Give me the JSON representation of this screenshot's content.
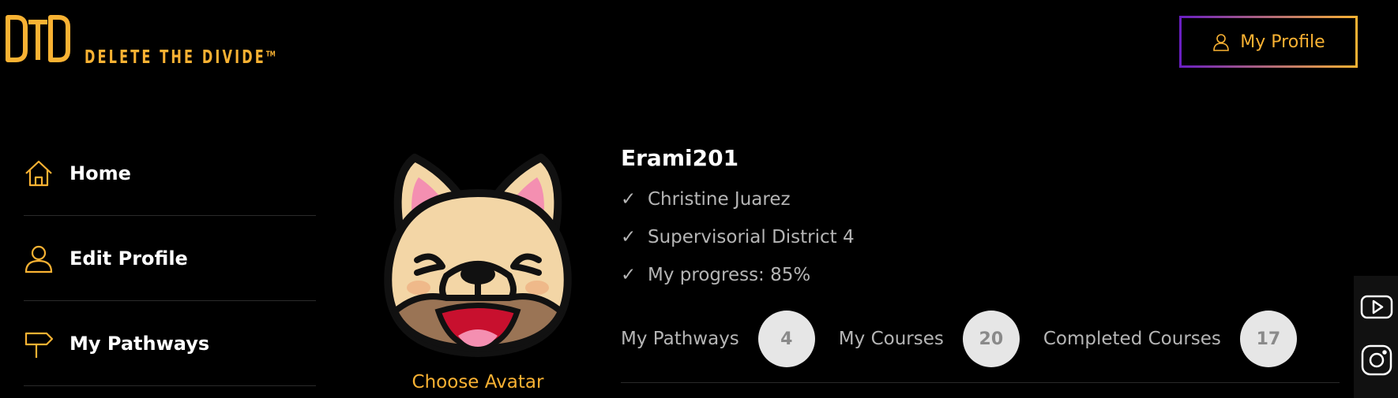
{
  "header": {
    "logo_text": "DELETE THE DIVIDE",
    "logo_tm": "TM",
    "logo_mark": "DTD",
    "profile_button": "My Profile"
  },
  "sidebar": {
    "items": [
      {
        "label": "Home",
        "icon": "home-icon"
      },
      {
        "label": "Edit Profile",
        "icon": "user-icon"
      },
      {
        "label": "My Pathways",
        "icon": "signpost-icon"
      }
    ]
  },
  "profile": {
    "avatar": "french-bulldog-avatar",
    "choose_avatar": "Choose Avatar",
    "username": "Erami201",
    "check_mark": "✓",
    "name": "Christine Juarez",
    "district": "Supervisorial District 4",
    "progress": "My progress: 85%"
  },
  "stats": [
    {
      "label": "My Pathways",
      "value": "4"
    },
    {
      "label": "My Courses",
      "value": "20"
    },
    {
      "label": "Completed Courses",
      "value": "17"
    }
  ],
  "social": [
    "youtube-icon",
    "instagram-icon"
  ],
  "colors": {
    "accent": "#f9b233",
    "purple": "#6a1fc2",
    "background": "#000000"
  }
}
